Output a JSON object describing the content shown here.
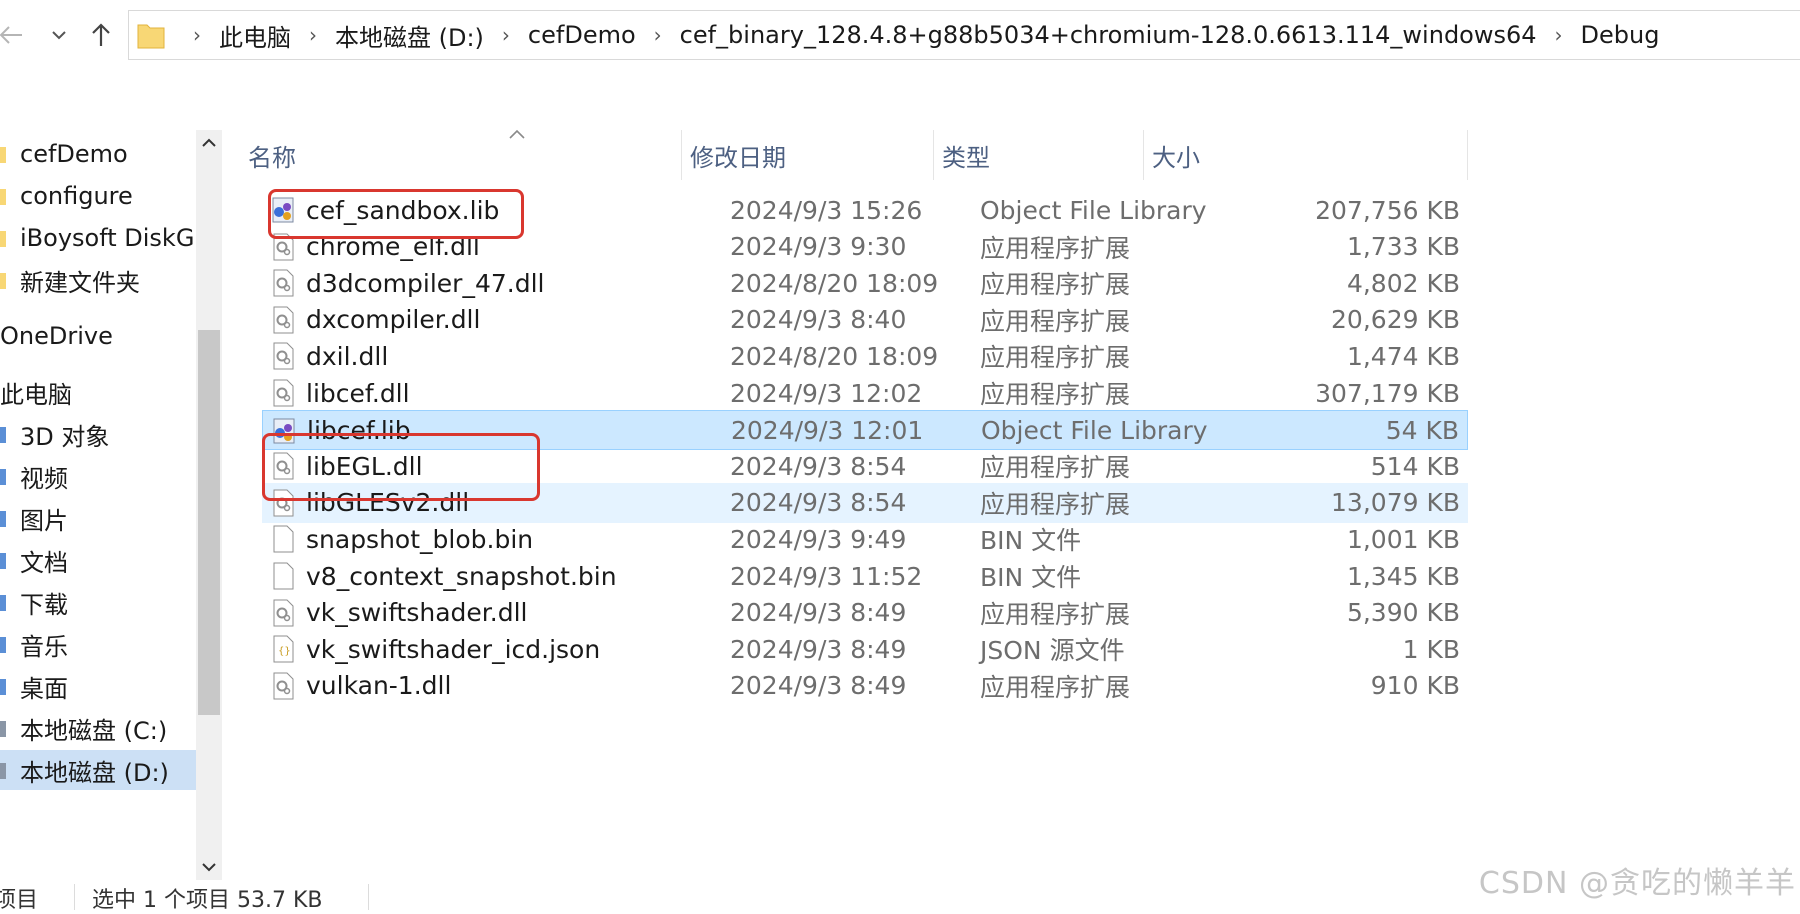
{
  "address": {
    "crumbs": [
      "此电脑",
      "本地磁盘 (D:)",
      "cefDemo",
      "cef_binary_128.4.8+g88b5034+chromium-128.0.6613.114_windows64",
      "Debug"
    ]
  },
  "nav": {
    "items": [
      {
        "label": "cefDemo",
        "icon": "folder-icon"
      },
      {
        "label": "configure",
        "icon": "folder-icon"
      },
      {
        "label": "iBoysoft DiskG",
        "icon": "folder-icon"
      },
      {
        "label": "新建文件夹",
        "icon": "folder-icon"
      },
      {
        "label": "OneDrive",
        "icon": "onedrive-icon"
      },
      {
        "label": "此电脑",
        "icon": "computer-icon"
      },
      {
        "label": "3D 对象",
        "icon": "3d-objects-icon"
      },
      {
        "label": "视频",
        "icon": "videos-icon"
      },
      {
        "label": "图片",
        "icon": "pictures-icon"
      },
      {
        "label": "文档",
        "icon": "documents-icon"
      },
      {
        "label": "下载",
        "icon": "downloads-icon"
      },
      {
        "label": "音乐",
        "icon": "music-icon"
      },
      {
        "label": "桌面",
        "icon": "desktop-icon"
      },
      {
        "label": "本地磁盘 (C:)",
        "icon": "drive-icon"
      },
      {
        "label": "本地磁盘 (D:)",
        "icon": "drive-icon"
      }
    ]
  },
  "columns": {
    "name": "名称",
    "date": "修改日期",
    "type": "类型",
    "size": "大小"
  },
  "files": [
    {
      "name": "cef_sandbox.lib",
      "date": "2024/9/3 15:26",
      "type": "Object File Library",
      "size": "207,756 KB",
      "icon": "lib-file-icon"
    },
    {
      "name": "chrome_elf.dll",
      "date": "2024/9/3 9:30",
      "type": "应用程序扩展",
      "size": "1,733 KB",
      "icon": "dll-file-icon"
    },
    {
      "name": "d3dcompiler_47.dll",
      "date": "2024/8/20 18:09",
      "type": "应用程序扩展",
      "size": "4,802 KB",
      "icon": "dll-file-icon"
    },
    {
      "name": "dxcompiler.dll",
      "date": "2024/9/3 8:40",
      "type": "应用程序扩展",
      "size": "20,629 KB",
      "icon": "dll-file-icon"
    },
    {
      "name": "dxil.dll",
      "date": "2024/8/20 18:09",
      "type": "应用程序扩展",
      "size": "1,474 KB",
      "icon": "dll-file-icon"
    },
    {
      "name": "libcef.dll",
      "date": "2024/9/3 12:02",
      "type": "应用程序扩展",
      "size": "307,179 KB",
      "icon": "dll-file-icon"
    },
    {
      "name": "libcef.lib",
      "date": "2024/9/3 12:01",
      "type": "Object File Library",
      "size": "54 KB",
      "icon": "lib-file-icon"
    },
    {
      "name": "libEGL.dll",
      "date": "2024/9/3 8:54",
      "type": "应用程序扩展",
      "size": "514 KB",
      "icon": "dll-file-icon"
    },
    {
      "name": "libGLESv2.dll",
      "date": "2024/9/3 8:54",
      "type": "应用程序扩展",
      "size": "13,079 KB",
      "icon": "dll-file-icon"
    },
    {
      "name": "snapshot_blob.bin",
      "date": "2024/9/3 9:49",
      "type": "BIN 文件",
      "size": "1,001 KB",
      "icon": "blank-file-icon"
    },
    {
      "name": "v8_context_snapshot.bin",
      "date": "2024/9/3 11:52",
      "type": "BIN 文件",
      "size": "1,345 KB",
      "icon": "blank-file-icon"
    },
    {
      "name": "vk_swiftshader.dll",
      "date": "2024/9/3 8:49",
      "type": "应用程序扩展",
      "size": "5,390 KB",
      "icon": "dll-file-icon"
    },
    {
      "name": "vk_swiftshader_icd.json",
      "date": "2024/9/3 8:49",
      "type": "JSON 源文件",
      "size": "1 KB",
      "icon": "json-file-icon"
    },
    {
      "name": "vulkan-1.dll",
      "date": "2024/9/3 8:49",
      "type": "应用程序扩展",
      "size": "910 KB",
      "icon": "dll-file-icon"
    }
  ],
  "selected_file": "libcef.lib",
  "hover_file": "libGLESv2.dll",
  "status": {
    "count": "项目",
    "selected": "选中 1 个项目  53.7 KB"
  },
  "watermark": "CSDN @贪吃的懒羊羊",
  "colors": {
    "highlight": "#d9372f",
    "selection": "#cce8ff",
    "hover": "#e5f3ff",
    "header_text": "#4d6082"
  }
}
